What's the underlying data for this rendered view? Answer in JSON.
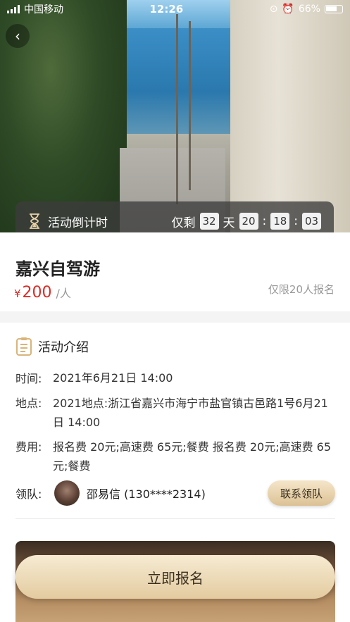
{
  "status_bar": {
    "carrier": "中国移动",
    "time": "12:26",
    "battery": "66%"
  },
  "countdown": {
    "label": "活动倒计时",
    "prefix": "仅剩",
    "days": "32",
    "days_unit": "天",
    "hours": "20",
    "minutes": "18",
    "seconds": "03",
    "separator": ":"
  },
  "event": {
    "title": "嘉兴自驾游",
    "currency": "¥",
    "price": "200",
    "per": "/人",
    "limit": "仅限20人报名"
  },
  "intro": {
    "heading": "活动介绍",
    "time_label": "时间:",
    "time_value": "2021年6月21日 14:00",
    "place_label": "地点:",
    "place_value": "2021地点:浙江省嘉兴市海宁市盐官镇古邑路1号6月21日 14:00",
    "fee_label": "费用:",
    "fee_value": "报名费 20元;高速费 65元;餐费 报名费 20元;高速费 65元;餐费",
    "leader_label": "领队:",
    "leader_name": "邵易信 (130****2314)",
    "contact_button": "联系领队"
  },
  "footer": {
    "signup_button": "立即报名"
  },
  "icons": {
    "back": "chevron-left-icon",
    "hourglass": "hourglass-icon",
    "intro": "document-icon"
  },
  "colors": {
    "price": "#e02a25",
    "accent_gold": "#e3cba0"
  }
}
